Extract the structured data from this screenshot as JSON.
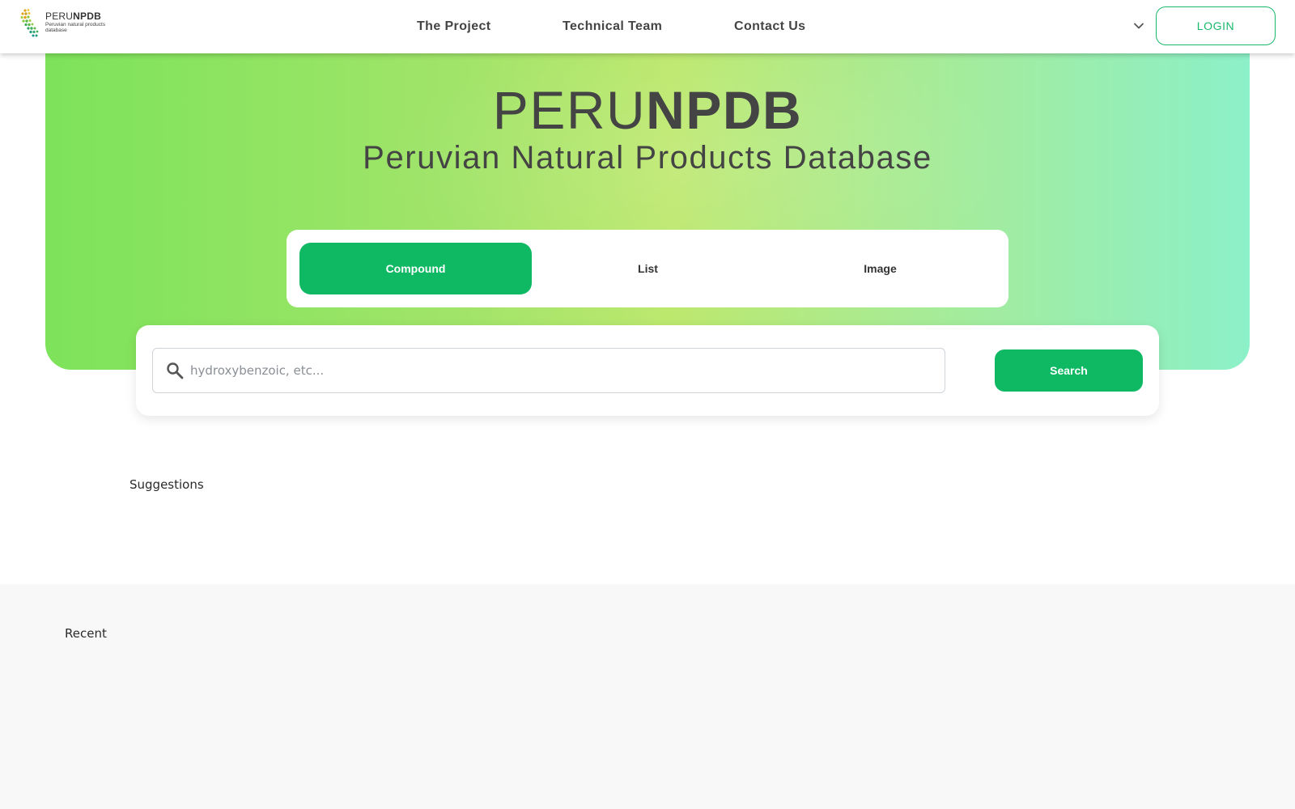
{
  "brand": {
    "logo_title_light": "PERU",
    "logo_title_bold": "NPDB",
    "logo_subtitle": "Peruvian natural products database"
  },
  "nav": {
    "links": [
      {
        "label": "The Project"
      },
      {
        "label": "Technical Team"
      },
      {
        "label": "Contact Us"
      }
    ],
    "language_icon": "chevron-down-icon",
    "login_label": "LOGIN"
  },
  "hero": {
    "title_light": "PERU",
    "title_bold": "NPDB",
    "subtitle": "Peruvian Natural Products Database"
  },
  "search_modes": {
    "tabs": [
      {
        "label": "Compound",
        "active": true
      },
      {
        "label": "List",
        "active": false
      },
      {
        "label": "Image",
        "active": false
      }
    ]
  },
  "search": {
    "icon": "search-icon",
    "placeholder": "hydroxybenzoic, etc...",
    "value": "",
    "button_label": "Search"
  },
  "sections": {
    "suggestions_label": "Suggestions",
    "recent_label": "Recent"
  },
  "colors": {
    "accent_green": "#0fb964",
    "hero_gradient_start": "#7de35a",
    "hero_gradient_end": "#8cf0c8",
    "recent_background": "#f8f8f8"
  }
}
